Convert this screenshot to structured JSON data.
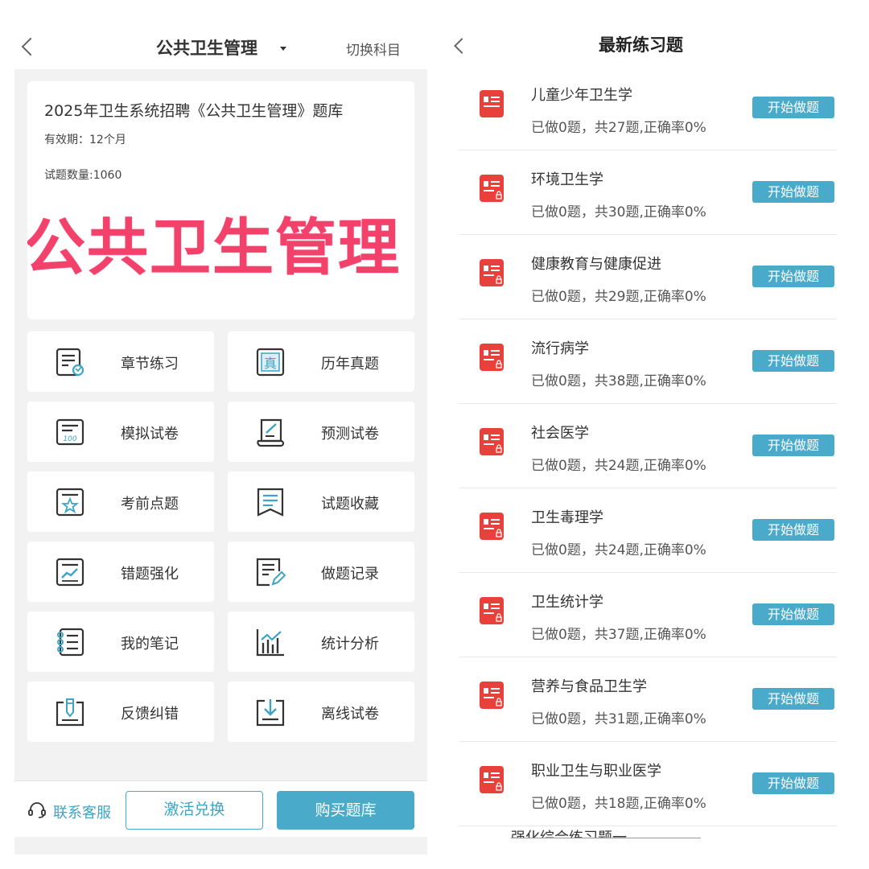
{
  "left": {
    "header": {
      "title": "公共卫生管理",
      "switch_label": "切换科目"
    },
    "card": {
      "title": "2025年卫生系统招聘《公共卫生管理》题库",
      "validity": "有效期：12个月",
      "count": "试题数量:1060",
      "banner": "公共卫生管理"
    },
    "menu": [
      {
        "label": "章节练习",
        "icon": "chapter-practice-icon"
      },
      {
        "label": "历年真题",
        "icon": "past-exams-icon"
      },
      {
        "label": "模拟试卷",
        "icon": "mock-exam-icon"
      },
      {
        "label": "预测试卷",
        "icon": "prediction-exam-icon"
      },
      {
        "label": "考前点题",
        "icon": "pre-exam-tips-icon"
      },
      {
        "label": "试题收藏",
        "icon": "bookmark-icon"
      },
      {
        "label": "错题强化",
        "icon": "wrong-questions-icon"
      },
      {
        "label": "做题记录",
        "icon": "practice-record-icon"
      },
      {
        "label": "我的笔记",
        "icon": "notes-icon"
      },
      {
        "label": "统计分析",
        "icon": "statistics-icon"
      },
      {
        "label": "反馈纠错",
        "icon": "feedback-icon"
      },
      {
        "label": "离线试卷",
        "icon": "offline-download-icon"
      }
    ],
    "footer": {
      "service_label": "联系客服",
      "activate_label": "激活兑换",
      "buy_label": "购买题库"
    }
  },
  "right": {
    "title": "最新练习题",
    "button_label": "开始做题",
    "items": [
      {
        "name": "儿童少年卫生学",
        "stats": "已做0题，共27题,正确率0%",
        "locked": false
      },
      {
        "name": "环境卫生学",
        "stats": "已做0题，共30题,正确率0%",
        "locked": true
      },
      {
        "name": "健康教育与健康促进",
        "stats": "已做0题，共29题,正确率0%",
        "locked": true
      },
      {
        "name": "流行病学",
        "stats": "已做0题，共38题,正确率0%",
        "locked": true
      },
      {
        "name": "社会医学",
        "stats": "已做0题，共24题,正确率0%",
        "locked": true
      },
      {
        "name": "卫生毒理学",
        "stats": "已做0题，共24题,正确率0%",
        "locked": true
      },
      {
        "name": "卫生统计学",
        "stats": "已做0题，共37题,正确率0%",
        "locked": true
      },
      {
        "name": "营养与食品卫生学",
        "stats": "已做0题，共31题,正确率0%",
        "locked": true
      },
      {
        "name": "职业卫生与职业医学",
        "stats": "已做0题，共18题,正确率0%",
        "locked": true
      }
    ],
    "partial_item": "强化综合练习题一"
  },
  "colors": {
    "accent": "#4aaac9",
    "banner": "#f2416b",
    "icon_red": "#e8413b",
    "background": "#f2f2f2"
  }
}
